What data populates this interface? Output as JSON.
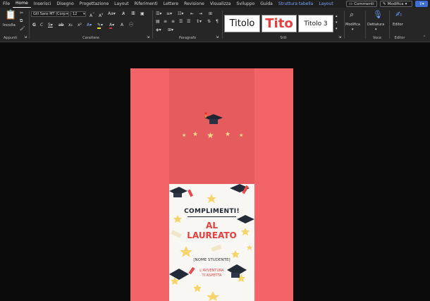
{
  "menu": {
    "tabs": [
      "File",
      "Home",
      "Inserisci",
      "Disegno",
      "Progettazione",
      "Layout",
      "Riferimenti",
      "Lettere",
      "Revisione",
      "Visualizza",
      "Sviluppo",
      "Guida",
      "Struttura tabella",
      "Layout"
    ],
    "active_tab": "Home",
    "comments_label": "Commenti",
    "edit_mode_label": "Modifica"
  },
  "ribbon": {
    "clipboard": {
      "paste_label": "Incolla",
      "group_label": "Appunti"
    },
    "font": {
      "font_name": "Gill Sans MT (Corp",
      "font_size": "12",
      "group_label": "Carattere"
    },
    "paragraph": {
      "group_label": "Paragrafo"
    },
    "styles": {
      "group_label": "Stili",
      "items": [
        "Titolo",
        "Tito",
        "Titolo 3"
      ]
    },
    "editing": {
      "label": "Modifica"
    },
    "voice": {
      "dictate_label": "Dettatura",
      "group_label": "Voce"
    },
    "editor": {
      "label": "Editor",
      "group_label": "Editor"
    }
  },
  "card": {
    "headline": "COMPLIMENTI!",
    "title_line1": "AL",
    "title_line2": "LAUREATO",
    "name_placeholder": "[NOME STUDENTE]",
    "footer_line1": "L'AVVENTURA",
    "footer_line2": "TI ASPETTA"
  },
  "colors": {
    "page": "#f26467",
    "band": "#e65b5e",
    "title_red": "#e63e3e",
    "accent_blue": "#79a9ff"
  }
}
